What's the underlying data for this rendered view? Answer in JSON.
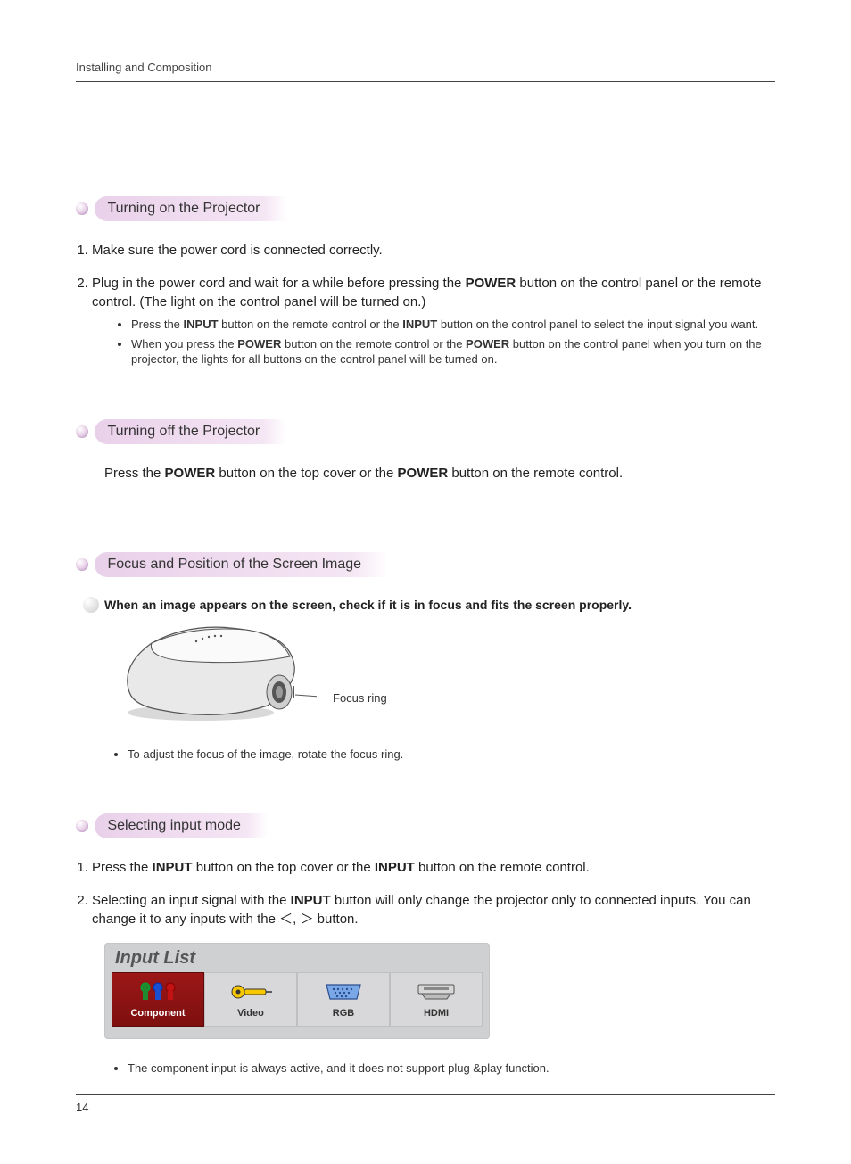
{
  "header": "Installing and Composition",
  "page_number": "14",
  "sections": {
    "turn_on": {
      "title": "Turning on the Projector",
      "step1": "Make sure the power cord is connected correctly.",
      "step2_a": "Plug in the power cord and wait for a while before pressing the ",
      "step2_power": "POWER",
      "step2_b": " button on the control panel or the remote control. (The light on the control panel will be turned on.)",
      "sub1_a": "Press the ",
      "sub1_input1": "INPUT",
      "sub1_b": " button on the remote control or the ",
      "sub1_input2": "INPUT",
      "sub1_c": " button on the control panel to select the input signal you want.",
      "sub2_a": "When you press the ",
      "sub2_power1": "POWER",
      "sub2_b": " button on the remote control or the ",
      "sub2_power2": "POWER",
      "sub2_c": " button on the control panel when you turn on the projector, the lights for all buttons on the control panel will be turned on."
    },
    "turn_off": {
      "title": "Turning off the Projector",
      "text_a": "Press the ",
      "text_power1": "POWER",
      "text_b": " button on the top cover or the ",
      "text_power2": "POWER",
      "text_c": " button on the remote control."
    },
    "focus": {
      "title": "Focus and Position of the Screen Image",
      "callout": "When an image appears on the screen, check if it is in focus and fits the screen properly.",
      "focus_ring_label": "Focus ring",
      "bullet": "To adjust the focus of the image, rotate the focus ring."
    },
    "select_input": {
      "title": "Selecting input mode",
      "step1_a": "Press the ",
      "step1_input1": "INPUT",
      "step1_b": " button on the top cover or the ",
      "step1_input2": "INPUT",
      "step1_c": " button on the remote control.",
      "step2_a": "Selecting an input signal with the ",
      "step2_input": "INPUT",
      "step2_b": " button will only change the projector only to connected inputs. You can change it to any inputs with the ",
      "step2_lt": "＜",
      "step2_comma": ", ",
      "step2_gt": "＞",
      "step2_c": " button.",
      "panel_title": "Input List",
      "tiles": {
        "component": "Component",
        "video": "Video",
        "rgb": "RGB",
        "hdmi": "HDMI"
      },
      "note": "The component input is always active, and it does not support plug &play function."
    }
  }
}
